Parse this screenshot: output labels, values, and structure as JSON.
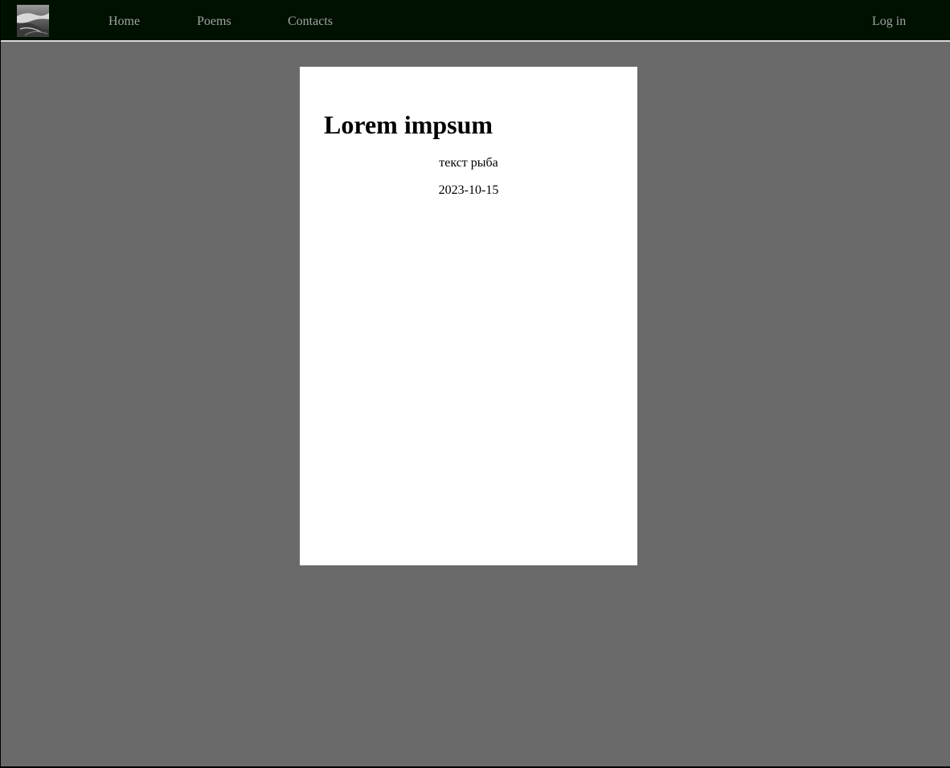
{
  "navbar": {
    "logo_icon": "landscape-thumbnail-icon",
    "links": {
      "home": "Home",
      "poems": "Poems",
      "contacts": "Contacts"
    },
    "login": "Log in"
  },
  "poem": {
    "title": "Lorem impsum",
    "text": "текст рыба",
    "date": "2023-10-15"
  },
  "colors": {
    "navbar_bg": "#001100",
    "page_bg": "#6a6a6a",
    "card_bg": "#ffffff",
    "nav_link": "#a3a3a3"
  }
}
